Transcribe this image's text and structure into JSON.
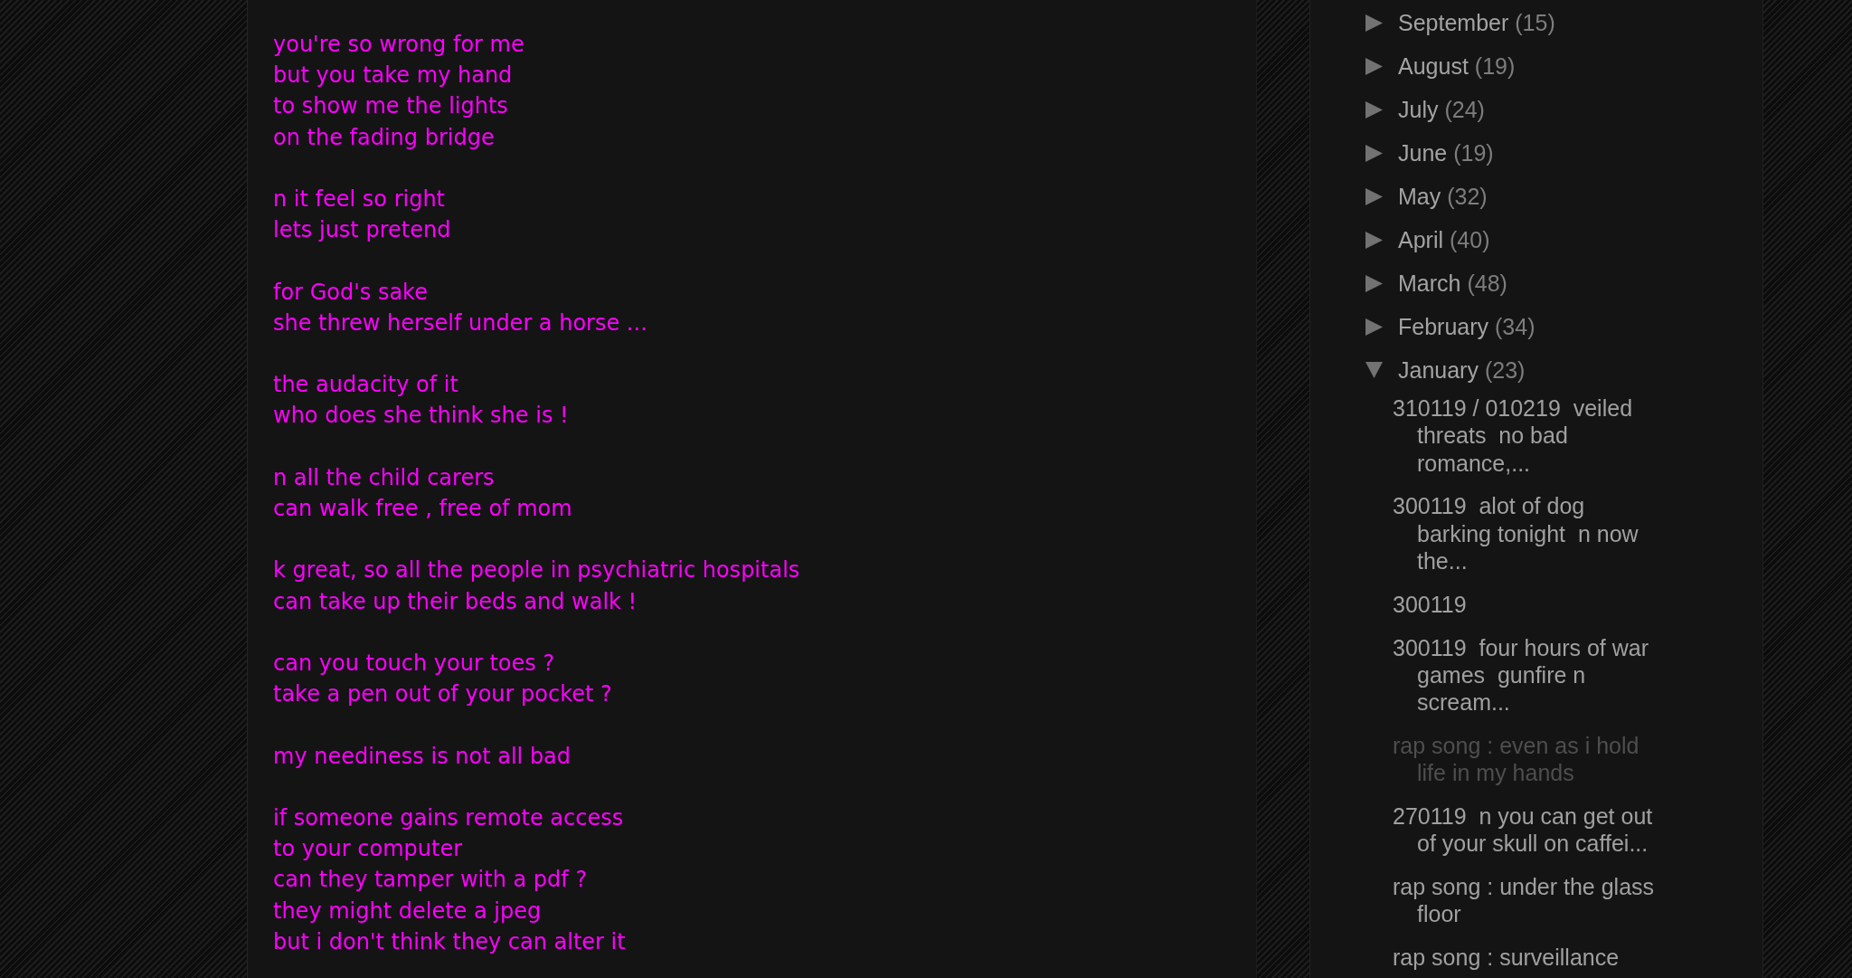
{
  "post": {
    "stanzas": [
      [
        "you're so wrong for me",
        "but you take my hand",
        "to show me the lights",
        "on the fading bridge"
      ],
      [
        "n it feel so right",
        "lets just pretend"
      ],
      [
        "for God's sake",
        "she threw herself under a horse ..."
      ],
      [
        "the audacity of it",
        "who does she think she is !"
      ],
      [
        "n all the child carers",
        "can walk free , free of mom"
      ],
      [
        "k great, so all the people in psychiatric hospitals",
        "can take up their beds and walk !"
      ],
      [
        "can you touch your toes ?",
        "take a pen out of your pocket ?"
      ],
      [
        "my neediness is not all bad"
      ],
      [
        "if someone gains remote access",
        "to your computer",
        "can they tamper with a pdf ?",
        "they might delete a jpeg",
        "but i don't think they can alter it"
      ]
    ]
  },
  "sidebar": {
    "archive": [
      {
        "label": "September",
        "count": "(15)",
        "expanded": false
      },
      {
        "label": "August",
        "count": "(19)",
        "expanded": false
      },
      {
        "label": "July",
        "count": "(24)",
        "expanded": false
      },
      {
        "label": "June",
        "count": "(19)",
        "expanded": false
      },
      {
        "label": "May",
        "count": "(32)",
        "expanded": false
      },
      {
        "label": "April",
        "count": "(40)",
        "expanded": false
      },
      {
        "label": "March",
        "count": "(48)",
        "expanded": false
      },
      {
        "label": "February",
        "count": "(34)",
        "expanded": false
      },
      {
        "label": "January",
        "count": "(23)",
        "expanded": true,
        "children": [
          {
            "title": "310119 / 010219  veiled threats  no bad romance,...",
            "visited": false
          },
          {
            "title": "300119  alot of dog barking tonight  n now the...",
            "visited": false
          },
          {
            "title": "300119",
            "visited": false
          },
          {
            "title": "300119  four hours of war games  gunfire n scream...",
            "visited": false
          },
          {
            "title": "rap song : even as i hold life in my hands",
            "visited": true
          },
          {
            "title": "270119  n you can get out of your skull on caffei...",
            "visited": false
          },
          {
            "title": "rap song : under the glass floor",
            "visited": false
          },
          {
            "title": "rap song : surveillance",
            "visited": false
          }
        ]
      }
    ]
  }
}
